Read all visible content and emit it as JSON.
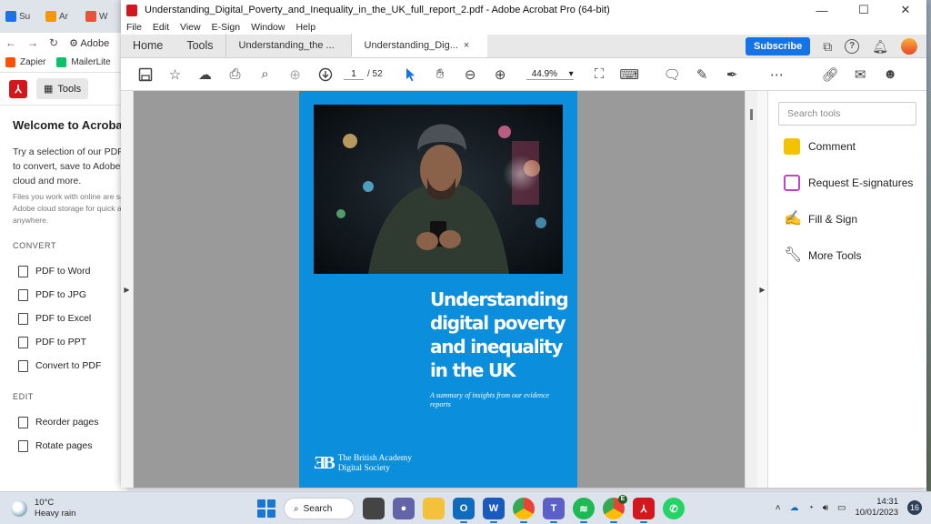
{
  "background_browser": {
    "tabs": [
      {
        "label": "Su",
        "color": "#1a73e8"
      },
      {
        "label": "Ar",
        "color": "#f29900"
      },
      {
        "label": "W",
        "color": "#e8533b"
      }
    ],
    "address": "Adobe",
    "bookmarks": [
      {
        "label": "Zapier",
        "color": "#ff4f00"
      },
      {
        "label": "MailerLite",
        "color": "#09c269"
      }
    ],
    "acrobat_web": {
      "tools_label": "Tools",
      "welcome_title": "Welcome to Acrobat",
      "welcome_text": "Try a selection of our PDF to convert, save to Adobe cloud and more.",
      "welcome_small": "Files you work with online are sav Adobe cloud storage for quick acc anywhere.",
      "convert_heading": "CONVERT",
      "convert_items": [
        "PDF to Word",
        "PDF to JPG",
        "PDF to Excel",
        "PDF to PPT",
        "Convert to PDF"
      ],
      "edit_heading": "EDIT",
      "edit_items": [
        "Reorder pages",
        "Rotate pages"
      ]
    }
  },
  "acrobat": {
    "title": "Understanding_Digital_Poverty_and_Inequality_in_the_UK_full_report_2.pdf - Adobe Acrobat Pro (64-bit)",
    "menu": [
      "File",
      "Edit",
      "View",
      "E-Sign",
      "Window",
      "Help"
    ],
    "nav_tabs": {
      "home": "Home",
      "tools": "Tools"
    },
    "doc_tabs": [
      {
        "label": "Understanding_the ..."
      },
      {
        "label": "Understanding_Dig...",
        "close": "×"
      }
    ],
    "subscribe_label": "Subscribe",
    "page_current": "1",
    "page_total": "/ 52",
    "zoom": "44.9%",
    "search_tools_placeholder": "Search tools",
    "right_tools": [
      {
        "label": "Comment",
        "color": "#f2c200"
      },
      {
        "label": "Request E-signatures",
        "color": "#c143c8"
      },
      {
        "label": "Fill & Sign",
        "color": "#8f54e5"
      },
      {
        "label": "More Tools",
        "color": "#444444"
      }
    ],
    "cover": {
      "title": "Understanding digital poverty and inequality in the UK",
      "subtitle": "A summary of insights from our evidence reports",
      "brand_line1": "The British Academy",
      "brand_line2": "Digital Society",
      "background_color": "#0b8fdd"
    }
  },
  "taskbar": {
    "weather_temp": "10°C",
    "weather_desc": "Heavy rain",
    "search_label": "Search",
    "time": "14:31",
    "date": "10/01/2023",
    "notifications": "16",
    "profile_badge": "E"
  }
}
